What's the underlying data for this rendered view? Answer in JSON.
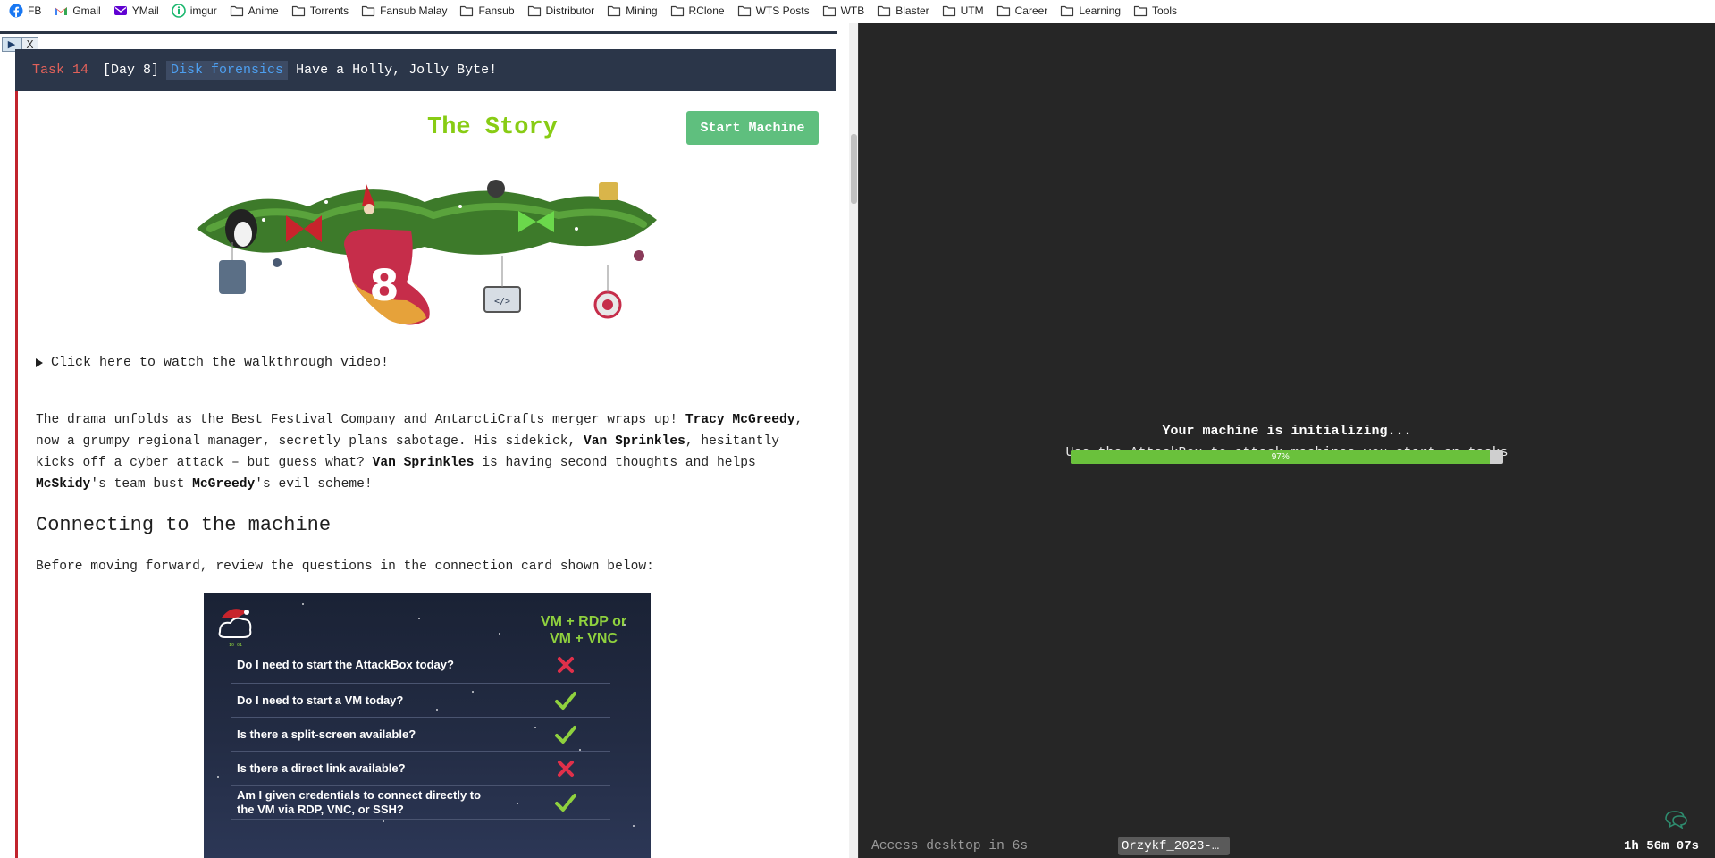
{
  "bookmarks": [
    {
      "label": "FB",
      "icon": "facebook-icon"
    },
    {
      "label": "Gmail",
      "icon": "gmail-icon"
    },
    {
      "label": "YMail",
      "icon": "yahoo-mail-icon"
    },
    {
      "label": "imgur",
      "icon": "imgur-icon"
    },
    {
      "label": "Anime",
      "icon": "folder-icon"
    },
    {
      "label": "Torrents",
      "icon": "folder-icon"
    },
    {
      "label": "Fansub Malay",
      "icon": "folder-icon"
    },
    {
      "label": "Fansub",
      "icon": "folder-icon"
    },
    {
      "label": "Distributor",
      "icon": "folder-icon"
    },
    {
      "label": "Mining",
      "icon": "folder-icon"
    },
    {
      "label": "RClone",
      "icon": "folder-icon"
    },
    {
      "label": "WTS Posts",
      "icon": "folder-icon"
    },
    {
      "label": "WTB",
      "icon": "folder-icon"
    },
    {
      "label": "Blaster",
      "icon": "folder-icon"
    },
    {
      "label": "UTM",
      "icon": "folder-icon"
    },
    {
      "label": "Career",
      "icon": "folder-icon"
    },
    {
      "label": "Learning",
      "icon": "folder-icon"
    },
    {
      "label": "Tools",
      "icon": "folder-icon"
    }
  ],
  "pip": {
    "play": "▶",
    "close": "X"
  },
  "task": {
    "number": "Task 14",
    "day": "[Day 8]",
    "tag": "Disk forensics",
    "title": "Have a Holly, Jolly Byte!"
  },
  "story": {
    "title": "The Story",
    "start_button": "Start Machine",
    "garland_number": "8",
    "walkthrough": "Click here to watch the walkthrough video!",
    "paragraph": {
      "p1": "The drama unfolds as the Best Festival Company and AntarctiCrafts merger wraps up! ",
      "n1": "Tracy McGreedy",
      "p2": ", now a grumpy regional manager, secretly plans sabotage. His sidekick, ",
      "n2": "Van Sprinkles",
      "p3": ", hesitantly kicks off a cyber attack – but guess what? ",
      "n3": "Van Sprinkles",
      "p4": " is having second thoughts and helps ",
      "n4": "McSkidy",
      "p5": "'s team bust ",
      "n5": "McGreedy",
      "p6": "'s evil scheme!"
    },
    "heading": "Connecting to the machine",
    "before": "Before moving forward, review the questions in the connection card shown below:"
  },
  "card": {
    "header_line1": "VM + RDP or",
    "header_line2": "VM + VNC",
    "rows": [
      {
        "q": "Do I need to start the AttackBox today?",
        "a": "no"
      },
      {
        "q": "Do I need to start a VM today?",
        "a": "yes"
      },
      {
        "q": "Is there a split-screen available?",
        "a": "yes"
      },
      {
        "q": "Is there a direct link available?",
        "a": "no"
      },
      {
        "q": "Am I given credentials to connect directly to the VM via RDP, VNC, or SSH?",
        "a": "yes"
      }
    ]
  },
  "machine": {
    "status": "Your machine is initializing...",
    "hint": "Use the AttackBox to attack machines you start on tasks",
    "progress": 97,
    "progress_label": "97%",
    "access": "Access desktop in 6s",
    "name": "Orzykf_2023-…",
    "timer": "1h 56m 07s"
  },
  "colors": {
    "story_title": "#88cc14",
    "start_button": "#5fbf7e",
    "progress_fill": "#6ac13c",
    "task_number": "#e0615a",
    "task_tag": "#4d9ff0",
    "check": "#8fd13e",
    "cross": "#e0304a"
  }
}
